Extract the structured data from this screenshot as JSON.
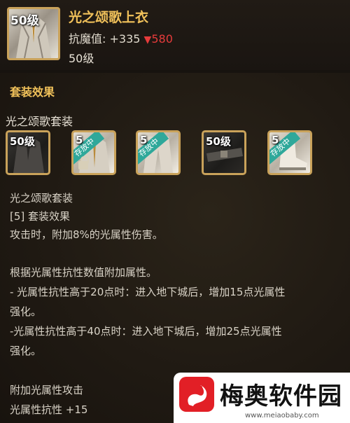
{
  "item": {
    "level_badge": "50级",
    "name": "光之颂歌上衣",
    "stat_label": "抗魔值:",
    "stat_value": "+335",
    "stat_delta": "580",
    "level": "50级"
  },
  "set": {
    "section_title": "套装效果",
    "name": "光之颂歌套装",
    "pieces": [
      {
        "level": "50级",
        "tag": ""
      },
      {
        "level": "5",
        "tag": "存放中"
      },
      {
        "level": "5",
        "tag": "存放中"
      },
      {
        "level": "50级",
        "tag": ""
      },
      {
        "level": "5",
        "tag": "存放中"
      }
    ]
  },
  "description": {
    "set_name": "光之颂歌套装",
    "effect_header": "[5] 套装效果",
    "effect_1": "攻击时，附加8%的光属性伤害。",
    "basis": "根据光属性抗性数值附加属性。",
    "rule_1a": "- 光属性抗性高于20点时：进入地下城后，增加15点光属性",
    "rule_1b": "强化。",
    "rule_2a": "-光属性抗性高于40点时：进入地下城后，增加25点光属性",
    "rule_2b": "强化。",
    "extra_header": "附加光属性攻击",
    "extra_stat": "光属性抗性 +15"
  },
  "watermark": {
    "title": "梅奥软件园",
    "url": "www.meiaobaby.com"
  },
  "colors": {
    "gold_border": "#c9a25a",
    "title_gold": "#f0c15a",
    "red_delta": "#e63b3b",
    "ribbon_teal": "#2fa89a"
  }
}
